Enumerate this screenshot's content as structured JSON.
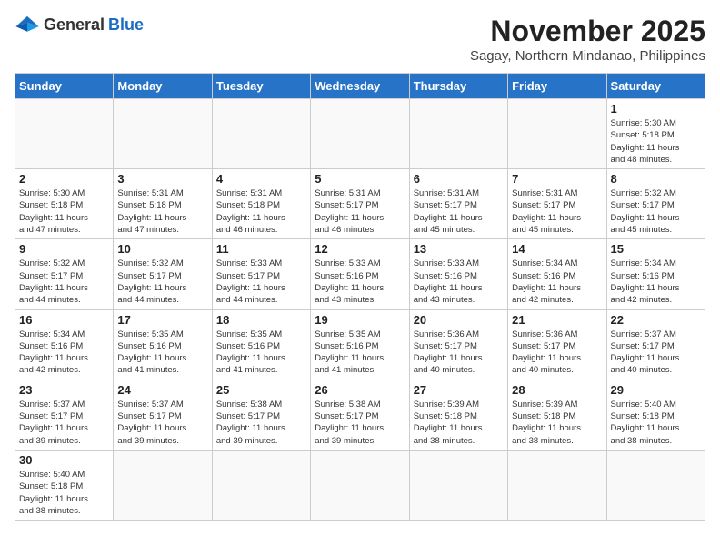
{
  "header": {
    "logo_general": "General",
    "logo_blue": "Blue",
    "month": "November 2025",
    "location": "Sagay, Northern Mindanao, Philippines"
  },
  "days_of_week": [
    "Sunday",
    "Monday",
    "Tuesday",
    "Wednesday",
    "Thursday",
    "Friday",
    "Saturday"
  ],
  "weeks": [
    [
      {
        "day": "",
        "info": ""
      },
      {
        "day": "",
        "info": ""
      },
      {
        "day": "",
        "info": ""
      },
      {
        "day": "",
        "info": ""
      },
      {
        "day": "",
        "info": ""
      },
      {
        "day": "",
        "info": ""
      },
      {
        "day": "1",
        "info": "Sunrise: 5:30 AM\nSunset: 5:18 PM\nDaylight: 11 hours\nand 48 minutes."
      }
    ],
    [
      {
        "day": "2",
        "info": "Sunrise: 5:30 AM\nSunset: 5:18 PM\nDaylight: 11 hours\nand 47 minutes."
      },
      {
        "day": "3",
        "info": "Sunrise: 5:31 AM\nSunset: 5:18 PM\nDaylight: 11 hours\nand 47 minutes."
      },
      {
        "day": "4",
        "info": "Sunrise: 5:31 AM\nSunset: 5:18 PM\nDaylight: 11 hours\nand 46 minutes."
      },
      {
        "day": "5",
        "info": "Sunrise: 5:31 AM\nSunset: 5:17 PM\nDaylight: 11 hours\nand 46 minutes."
      },
      {
        "day": "6",
        "info": "Sunrise: 5:31 AM\nSunset: 5:17 PM\nDaylight: 11 hours\nand 45 minutes."
      },
      {
        "day": "7",
        "info": "Sunrise: 5:31 AM\nSunset: 5:17 PM\nDaylight: 11 hours\nand 45 minutes."
      },
      {
        "day": "8",
        "info": "Sunrise: 5:32 AM\nSunset: 5:17 PM\nDaylight: 11 hours\nand 45 minutes."
      }
    ],
    [
      {
        "day": "9",
        "info": "Sunrise: 5:32 AM\nSunset: 5:17 PM\nDaylight: 11 hours\nand 44 minutes."
      },
      {
        "day": "10",
        "info": "Sunrise: 5:32 AM\nSunset: 5:17 PM\nDaylight: 11 hours\nand 44 minutes."
      },
      {
        "day": "11",
        "info": "Sunrise: 5:33 AM\nSunset: 5:17 PM\nDaylight: 11 hours\nand 44 minutes."
      },
      {
        "day": "12",
        "info": "Sunrise: 5:33 AM\nSunset: 5:16 PM\nDaylight: 11 hours\nand 43 minutes."
      },
      {
        "day": "13",
        "info": "Sunrise: 5:33 AM\nSunset: 5:16 PM\nDaylight: 11 hours\nand 43 minutes."
      },
      {
        "day": "14",
        "info": "Sunrise: 5:34 AM\nSunset: 5:16 PM\nDaylight: 11 hours\nand 42 minutes."
      },
      {
        "day": "15",
        "info": "Sunrise: 5:34 AM\nSunset: 5:16 PM\nDaylight: 11 hours\nand 42 minutes."
      }
    ],
    [
      {
        "day": "16",
        "info": "Sunrise: 5:34 AM\nSunset: 5:16 PM\nDaylight: 11 hours\nand 42 minutes."
      },
      {
        "day": "17",
        "info": "Sunrise: 5:35 AM\nSunset: 5:16 PM\nDaylight: 11 hours\nand 41 minutes."
      },
      {
        "day": "18",
        "info": "Sunrise: 5:35 AM\nSunset: 5:16 PM\nDaylight: 11 hours\nand 41 minutes."
      },
      {
        "day": "19",
        "info": "Sunrise: 5:35 AM\nSunset: 5:16 PM\nDaylight: 11 hours\nand 41 minutes."
      },
      {
        "day": "20",
        "info": "Sunrise: 5:36 AM\nSunset: 5:17 PM\nDaylight: 11 hours\nand 40 minutes."
      },
      {
        "day": "21",
        "info": "Sunrise: 5:36 AM\nSunset: 5:17 PM\nDaylight: 11 hours\nand 40 minutes."
      },
      {
        "day": "22",
        "info": "Sunrise: 5:37 AM\nSunset: 5:17 PM\nDaylight: 11 hours\nand 40 minutes."
      }
    ],
    [
      {
        "day": "23",
        "info": "Sunrise: 5:37 AM\nSunset: 5:17 PM\nDaylight: 11 hours\nand 39 minutes."
      },
      {
        "day": "24",
        "info": "Sunrise: 5:37 AM\nSunset: 5:17 PM\nDaylight: 11 hours\nand 39 minutes."
      },
      {
        "day": "25",
        "info": "Sunrise: 5:38 AM\nSunset: 5:17 PM\nDaylight: 11 hours\nand 39 minutes."
      },
      {
        "day": "26",
        "info": "Sunrise: 5:38 AM\nSunset: 5:17 PM\nDaylight: 11 hours\nand 39 minutes."
      },
      {
        "day": "27",
        "info": "Sunrise: 5:39 AM\nSunset: 5:18 PM\nDaylight: 11 hours\nand 38 minutes."
      },
      {
        "day": "28",
        "info": "Sunrise: 5:39 AM\nSunset: 5:18 PM\nDaylight: 11 hours\nand 38 minutes."
      },
      {
        "day": "29",
        "info": "Sunrise: 5:40 AM\nSunset: 5:18 PM\nDaylight: 11 hours\nand 38 minutes."
      }
    ],
    [
      {
        "day": "30",
        "info": "Sunrise: 5:40 AM\nSunset: 5:18 PM\nDaylight: 11 hours\nand 38 minutes."
      },
      {
        "day": "",
        "info": ""
      },
      {
        "day": "",
        "info": ""
      },
      {
        "day": "",
        "info": ""
      },
      {
        "day": "",
        "info": ""
      },
      {
        "day": "",
        "info": ""
      },
      {
        "day": "",
        "info": ""
      }
    ]
  ]
}
